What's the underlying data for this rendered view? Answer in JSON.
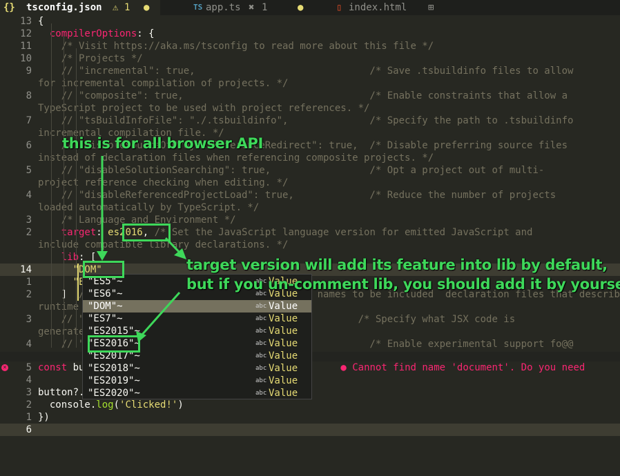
{
  "tabs": [
    {
      "icon": "{}",
      "name": "tsconfig.json",
      "warning_icon": "⚠",
      "count": "1",
      "dot": "●",
      "active": true
    },
    {
      "icon": "TS",
      "name": "app.ts",
      "error_icon": "✖",
      "count": "1",
      "dot": "●",
      "active": false
    },
    {
      "icon": "▯",
      "name": "index.html",
      "extra_icon": "⊞",
      "active": false
    }
  ],
  "editor": {
    "lines": [
      {
        "n": "13",
        "t": [
          [
            "p",
            "{"
          ]
        ]
      },
      {
        "n": "12",
        "t": [
          [
            "p",
            "  "
          ],
          [
            "k",
            "compilerOptions"
          ],
          [
            "p",
            ": {"
          ]
        ]
      },
      {
        "n": "11",
        "t": [
          [
            "c",
            "    /* Visit https://aka.ms/tsconfig to read more about this file */"
          ]
        ]
      },
      {
        "n": "10",
        "t": [
          [
            "c",
            "    /* Projects */"
          ]
        ]
      },
      {
        "n": "9",
        "t": [
          [
            "c",
            "    // \"incremental\": true,                              /* Save .tsbuildinfo files to allow"
          ]
        ]
      },
      {
        "n": "",
        "t": [
          [
            "c",
            "for incremental compilation of projects. */"
          ]
        ]
      },
      {
        "n": "8",
        "t": [
          [
            "c",
            "    // \"composite\": true,                                /* Enable constraints that allow a"
          ]
        ]
      },
      {
        "n": "",
        "t": [
          [
            "c",
            "TypeScript project to be used with project references. */"
          ]
        ]
      },
      {
        "n": "7",
        "t": [
          [
            "c",
            "    // \"tsBuildInfoFile\": \"./.tsbuildinfo\",              /* Specify the path to .tsbuildinfo"
          ]
        ]
      },
      {
        "n": "",
        "t": [
          [
            "c",
            "incremental compilation file. */"
          ]
        ]
      },
      {
        "n": "6",
        "t": [
          [
            "c",
            "    // \"disableSourceOfProjectReferenceRedirect\": true,  /* Disable preferring source files"
          ]
        ]
      },
      {
        "n": "",
        "t": [
          [
            "c",
            "instead of declaration files when referencing composite projects. */"
          ]
        ]
      },
      {
        "n": "5",
        "t": [
          [
            "c",
            "    // \"disableSolutionSearching\": true,                 /* Opt a project out of multi-"
          ]
        ]
      },
      {
        "n": "",
        "t": [
          [
            "c",
            "project reference checking when editing. */"
          ]
        ]
      },
      {
        "n": "4",
        "t": [
          [
            "c",
            "    // \"disableReferencedProjectLoad\": true,             /* Reduce the number of projects"
          ]
        ]
      },
      {
        "n": "",
        "t": [
          [
            "c",
            "loaded automatically by TypeScript. */"
          ]
        ]
      },
      {
        "n": "3",
        "t": [
          [
            "c",
            "    /* Language and Environment */"
          ]
        ]
      },
      {
        "n": "2",
        "t": [
          [
            "p",
            "    "
          ],
          [
            "k",
            "target"
          ],
          [
            "p",
            ": "
          ],
          [
            "s",
            "es2016"
          ],
          [
            "p",
            ", "
          ],
          [
            "c",
            "/* Set the JavaScript language version for emitted JavaScript and"
          ]
        ]
      },
      {
        "n": "",
        "t": [
          [
            "c",
            "include compatible library declarations. */"
          ]
        ]
      },
      {
        "n": "",
        "t": [
          [
            "p",
            "    "
          ],
          [
            "k",
            "lib"
          ],
          [
            "p",
            ": ["
          ]
        ]
      },
      {
        "n": "14",
        "t": [
          [
            "p",
            "      "
          ],
          [
            "s",
            "\"DOM\""
          ]
        ],
        "current": true
      },
      {
        "n": "1",
        "t": [
          [
            "p",
            "      "
          ],
          [
            "s",
            "\"ES5\"~"
          ]
        ]
      },
      {
        "n": "2",
        "t": [
          [
            "p",
            "    ]  "
          ],
          [
            "c",
            "// \"types\": [],  /* Specify type package names to be included  declaration files that describe the target"
          ]
        ]
      },
      {
        "n": "",
        "t": [
          [
            "c",
            "runtime environment. */"
          ]
        ]
      },
      {
        "n": "3",
        "t": [
          [
            "c",
            "    // \"jsx\": \"preserve\",                              /* Specify what JSX code is"
          ]
        ]
      },
      {
        "n": "",
        "t": [
          [
            "c",
            "generated. */"
          ]
        ]
      },
      {
        "n": "4",
        "t": [
          [
            "c",
            "    // \"experimentalDecorators\": true,                   /* Enable experimental support fo@@"
          ]
        ]
      }
    ],
    "lines2": [
      {
        "n": "5",
        "t": [
          [
            "k",
            "const"
          ],
          [
            "p",
            " button = "
          ],
          [
            "p",
            "document."
          ],
          [
            "f",
            "querySelector"
          ],
          [
            "p",
            "("
          ],
          [
            "s",
            "'button'"
          ],
          [
            "p",
            ")"
          ],
          [
            "p",
            "     "
          ],
          [
            "err",
            "● Cannot find name 'document'. Do you need"
          ]
        ],
        "err": true
      },
      {
        "n": "4",
        "t": [
          [
            "p",
            ""
          ]
        ]
      },
      {
        "n": "3",
        "t": [
          [
            "p",
            "button?."
          ],
          [
            "f",
            "addEventListener"
          ],
          [
            "p",
            "("
          ],
          [
            "s",
            "'click'"
          ],
          [
            "p",
            ", () => {"
          ]
        ]
      },
      {
        "n": "2",
        "t": [
          [
            "p",
            "  console."
          ],
          [
            "f",
            "log"
          ],
          [
            "p",
            "("
          ],
          [
            "s",
            "'Clicked!'"
          ],
          [
            "p",
            ")"
          ]
        ]
      },
      {
        "n": "1",
        "t": [
          [
            "p",
            "})"
          ]
        ]
      },
      {
        "n": "6",
        "t": [
          [
            "p",
            ""
          ]
        ],
        "current": true
      }
    ]
  },
  "suggestions": {
    "items": [
      {
        "label": "\"ES5\"~",
        "type": "abc",
        "value": "Value"
      },
      {
        "label": "\"ES6\"~",
        "type": "abc",
        "value": "Value"
      },
      {
        "label": "\"DOM\"~",
        "type": "abc",
        "value": "Value",
        "selected": true
      },
      {
        "label": "\"ES7\"~",
        "type": "abc",
        "value": "Value"
      },
      {
        "label": "\"ES2015\"~",
        "type": "abc",
        "value": "Value"
      },
      {
        "label": "\"ES2016\"~",
        "type": "abc",
        "value": "Value"
      },
      {
        "label": "\"ES2017\"~",
        "type": "abc",
        "value": "Value"
      },
      {
        "label": "\"ES2018\"~",
        "type": "abc",
        "value": "Value"
      },
      {
        "label": "\"ES2019\"~",
        "type": "abc",
        "value": "Value"
      },
      {
        "label": "\"ES2020\"~",
        "type": "abc",
        "value": "Value"
      }
    ]
  },
  "annotations": {
    "browser_api": "this is for all browser API",
    "target_line1": "target version will add its feature into lib by default,",
    "target_line2": "but if you un-comment lib, you should add it by yourself"
  },
  "colors": {
    "annotation": "#3ed85a",
    "keyword": "#f92672",
    "string": "#e6db74",
    "comment": "#75715e",
    "background": "#272822"
  }
}
